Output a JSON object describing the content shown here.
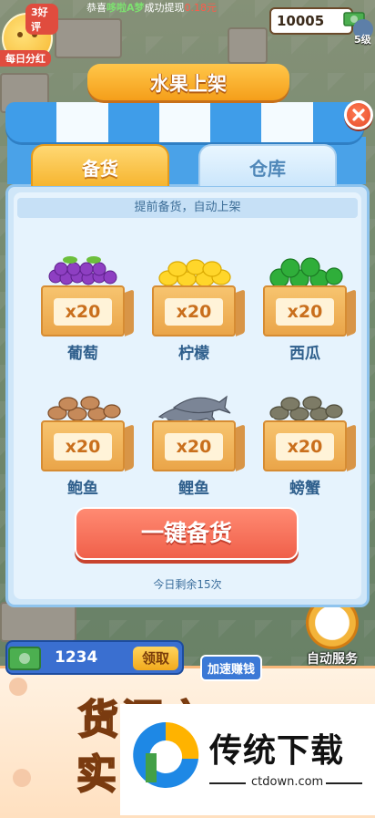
{
  "hud": {
    "rating": "3好评",
    "dividend": "每日分红",
    "ticker_prefix": "恭喜",
    "ticker_name": "哆啦A梦",
    "ticker_action": "成功提现",
    "ticker_amount": "0.18元",
    "coins": "10005",
    "level": "5级"
  },
  "modal": {
    "title": "水果上架",
    "tabs": [
      {
        "label": "备货",
        "active": true
      },
      {
        "label": "仓库",
        "active": false
      }
    ],
    "hint": "提前备货，自动上架",
    "items": [
      {
        "name": "葡萄",
        "qty": "x20",
        "icon": "grapes-icon"
      },
      {
        "name": "柠檬",
        "qty": "x20",
        "icon": "lemon-icon"
      },
      {
        "name": "西瓜",
        "qty": "x20",
        "icon": "watermelon-icon"
      },
      {
        "name": "鲍鱼",
        "qty": "x20",
        "icon": "abalone-icon"
      },
      {
        "name": "鲤鱼",
        "qty": "x20",
        "icon": "carp-icon"
      },
      {
        "name": "螃蟹",
        "qty": "x20",
        "icon": "crab-icon"
      }
    ],
    "action_label": "一键备货",
    "remaining": "今日剩余15次"
  },
  "bottom": {
    "cash": "1234",
    "claim_label": "领取",
    "speed_label": "加速赚钱",
    "auto_label": "自动服务",
    "promo_line1": "货源充",
    "promo_line2": "实"
  },
  "watermark": {
    "title": "传统下载",
    "url": "ctdown.com"
  },
  "colors": {
    "accent_blue": "#3f9de9",
    "action_red": "#f0604a",
    "crate_orange": "#eaa549",
    "label_blue": "#2f5f8c"
  }
}
